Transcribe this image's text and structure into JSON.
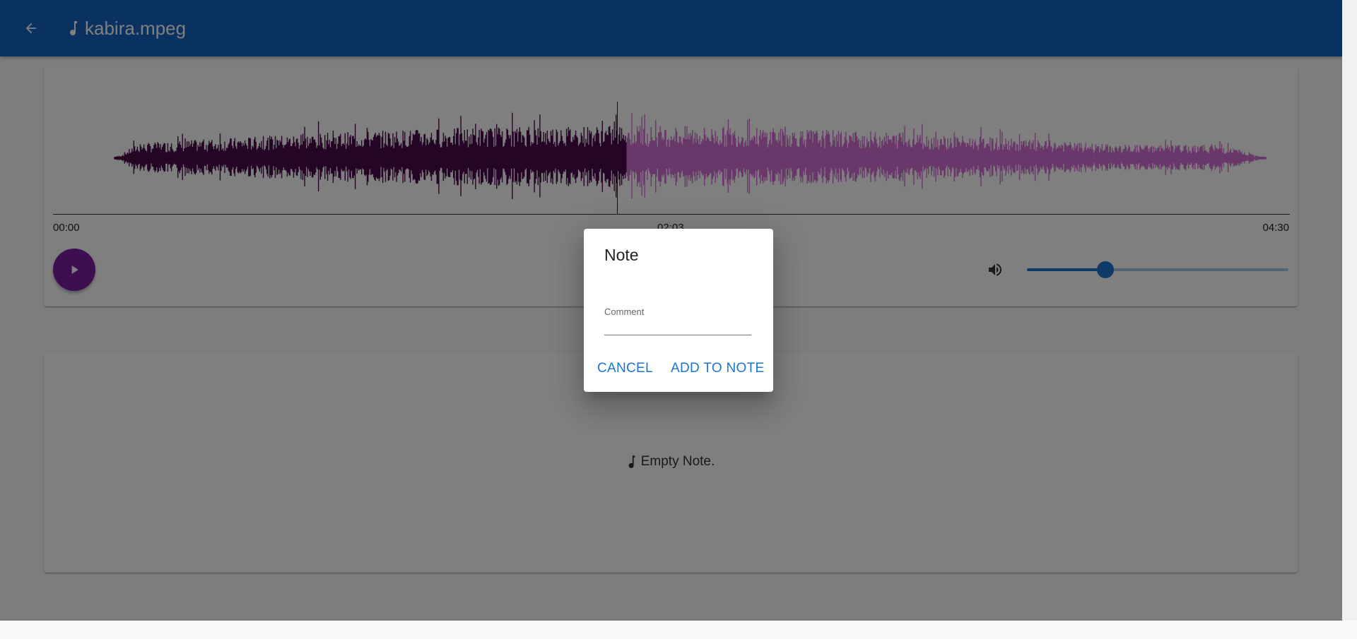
{
  "header": {
    "title": "kabira.mpeg",
    "back_icon": "arrow-left-icon",
    "file_icon": "music-note-icon",
    "color": "#1565c0"
  },
  "player": {
    "time_start": "00:00",
    "time_mid": "02:03",
    "time_end": "04:30",
    "progress_fraction": 0.445,
    "volume_fraction": 0.3,
    "played_color": "#4a0a4a",
    "unplayed_color": "#d36fd3",
    "play_button_color": "#7b1fa2",
    "play_icon": "play-icon",
    "volume_icon": "volume-up-icon"
  },
  "notes": {
    "empty_text": "Empty Note.",
    "empty_icon": "music-note-icon"
  },
  "dialog": {
    "title": "Note",
    "comment_label": "Comment",
    "comment_value": "",
    "cancel_label": "CANCEL",
    "add_label": "ADD TO NOTE",
    "button_color": "#1976d2"
  }
}
